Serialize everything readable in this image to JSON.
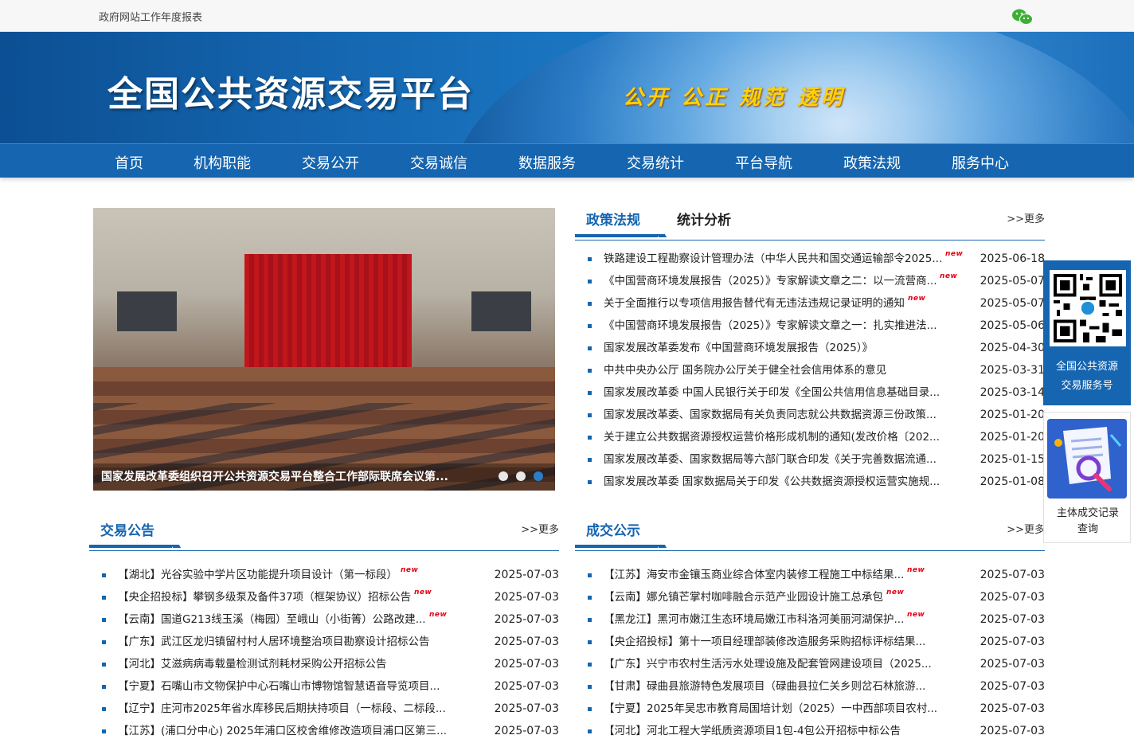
{
  "topbar": {
    "report_link": "政府网站工作年度报表",
    "wechat_icon": "wechat-icon"
  },
  "banner": {
    "title": "全国公共资源交易平台",
    "slogan": "公开 公正 规范 透明"
  },
  "nav": [
    "首页",
    "机构职能",
    "交易公开",
    "交易诚信",
    "数据服务",
    "交易统计",
    "平台导航",
    "政策法规",
    "服务中心"
  ],
  "slider": {
    "caption": "国家发展改革委组织召开公共资源交易平台整合工作部际联席会议第...",
    "dots": 3,
    "active_dot": 3
  },
  "policy": {
    "tabs": [
      "政策法规",
      "统计分析"
    ],
    "more": ">>更多",
    "items": [
      {
        "text": "铁路建设工程勘察设计管理办法（中华人民共和国交通运输部令2025...",
        "date": "2025-06-18",
        "new": true
      },
      {
        "text": "《中国营商环境发展报告（2025）》专家解读文章之二：以一流营商...",
        "date": "2025-05-07",
        "new": true
      },
      {
        "text": "关于全面推行以专项信用报告替代有无违法违规记录证明的通知",
        "date": "2025-05-07",
        "new": true
      },
      {
        "text": "《中国营商环境发展报告（2025）》专家解读文章之一：扎实推进法...",
        "date": "2025-05-06",
        "new": false
      },
      {
        "text": "国家发展改革委发布《中国营商环境发展报告（2025）》",
        "date": "2025-04-30",
        "new": false
      },
      {
        "text": "中共中央办公厅 国务院办公厅关于健全社会信用体系的意见",
        "date": "2025-03-31",
        "new": false
      },
      {
        "text": "国家发展改革委 中国人民银行关于印发《全国公共信用信息基础目录...",
        "date": "2025-03-14",
        "new": false
      },
      {
        "text": "国家发展改革委、国家数据局有关负责同志就公共数据资源三份政策...",
        "date": "2025-01-20",
        "new": false
      },
      {
        "text": "关于建立公共数据资源授权运营价格形成机制的通知(发改价格〔202...",
        "date": "2025-01-20",
        "new": false
      },
      {
        "text": "国家发展改革委、国家数据局等六部门联合印发《关于完善数据流通...",
        "date": "2025-01-15",
        "new": false
      },
      {
        "text": "国家发展改革委 国家数据局关于印发《公共数据资源授权运营实施规...",
        "date": "2025-01-08",
        "new": false
      }
    ]
  },
  "announce": {
    "title": "交易公告",
    "more": ">>更多",
    "items": [
      {
        "text": "【湖北】光谷实验中学片区功能提升项目设计（第一标段）",
        "date": "2025-07-03",
        "new": true
      },
      {
        "text": "【央企招投标】攀钢多级泵及备件37项（框架协议）招标公告",
        "date": "2025-07-03",
        "new": true
      },
      {
        "text": "【云南】国道G213线玉溪（梅园）至峨山（小街箐）公路改建...",
        "date": "2025-07-03",
        "new": true
      },
      {
        "text": "【广东】武江区龙归镇留村村人居环境整治项目勘察设计招标公告",
        "date": "2025-07-03",
        "new": false
      },
      {
        "text": "【河北】艾滋病病毒载量检测试剂耗材采购公开招标公告",
        "date": "2025-07-03",
        "new": false
      },
      {
        "text": "【宁夏】石嘴山市文物保护中心石嘴山市博物馆智慧语音导览项目...",
        "date": "2025-07-03",
        "new": false
      },
      {
        "text": "【辽宁】庄河市2025年省水库移民后期扶持项目（一标段、二标段...",
        "date": "2025-07-03",
        "new": false
      },
      {
        "text": "【江苏】(浦口分中心) 2025年浦口区校舍维修改造项目浦口区第三...",
        "date": "2025-07-03",
        "new": false
      }
    ]
  },
  "deals": {
    "title": "成交公示",
    "more": ">>更多",
    "items": [
      {
        "text": "【江苏】海安市金镶玉商业综合体室内装修工程施工中标结果...",
        "date": "2025-07-03",
        "new": true
      },
      {
        "text": "【云南】娜允镇芒掌村咖啡融合示范产业园设计施工总承包",
        "date": "2025-07-03",
        "new": true
      },
      {
        "text": "【黑龙江】黑河市嫩江生态环境局嫩江市科洛河美丽河湖保护...",
        "date": "2025-07-03",
        "new": true
      },
      {
        "text": "【央企招投标】第十一项目经理部装修改造服务采购招标评标结果...",
        "date": "2025-07-03",
        "new": false
      },
      {
        "text": "【广东】兴宁市农村生活污水处理设施及配套管网建设项目（2025...",
        "date": "2025-07-03",
        "new": false
      },
      {
        "text": "【甘肃】碌曲县旅游特色发展项目（碌曲县拉仁关乡则岔石林旅游...",
        "date": "2025-07-03",
        "new": false
      },
      {
        "text": "【宁夏】2025年吴忠市教育局国培计划（2025）一中西部项目农村...",
        "date": "2025-07-03",
        "new": false
      },
      {
        "text": "【河北】河北工程大学纸质资源项目1包-4包公开招标中标公告",
        "date": "2025-07-03",
        "new": false
      }
    ]
  },
  "new_badge": "new",
  "side": {
    "qr_label_1": "全国公共资源",
    "qr_label_2": "交易服务号",
    "record_label_1": "主体成交记录",
    "record_label_2": "查询"
  },
  "colors": {
    "primary": "#1565b0",
    "new_badge": "#e60012",
    "slogan": "#ffd200"
  }
}
